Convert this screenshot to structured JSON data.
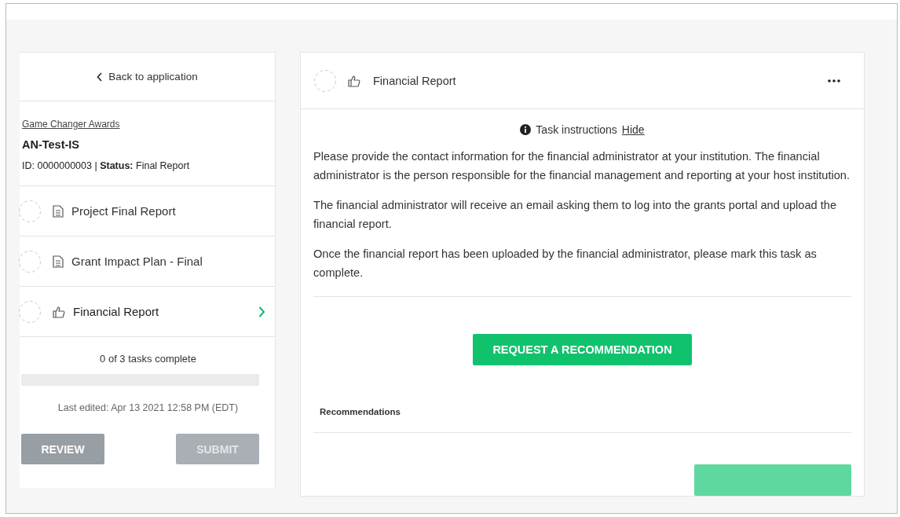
{
  "sidebar": {
    "back_link": "Back to application",
    "program_link": "Game Changer Awards",
    "application_name": "AN-Test-IS",
    "id_line": "ID: 0000000003 | **Status:** Final Report",
    "tasks": [
      {
        "label": "Project Final Report",
        "kind": "document",
        "selected": false
      },
      {
        "label": "Grant Impact Plan - Final",
        "kind": "document",
        "selected": false
      },
      {
        "label": "Financial Report",
        "kind": "thumb",
        "selected": true
      }
    ],
    "progress": {
      "text": "0 of 3 tasks complete"
    },
    "last_edited": "Last edited: Apr 13 2021 12:58 PM (EDT)",
    "buttons": [
      {
        "label": "REVIEW",
        "disabled": false
      },
      {
        "label": "SUBMIT",
        "disabled": true
      }
    ]
  },
  "task": {
    "title": "Financial Report",
    "kind": "thumb",
    "instructions_label": "Task instructions",
    "hide_link": "Hide",
    "paragraphs": [
      "Please provide the contact information for the financial administrator at your institution. The financial administrator is the person responsible for the financial management and reporting at your host institution.",
      "The financial administrator will receive an email asking them to log into the grants portal and upload the financial report.",
      "Once the financial report has been uploaded by the financial administrator, please mark this task as complete."
    ],
    "request_button": "REQUEST A RECOMMENDATION",
    "recommendations_label": "Recommendations"
  }
}
